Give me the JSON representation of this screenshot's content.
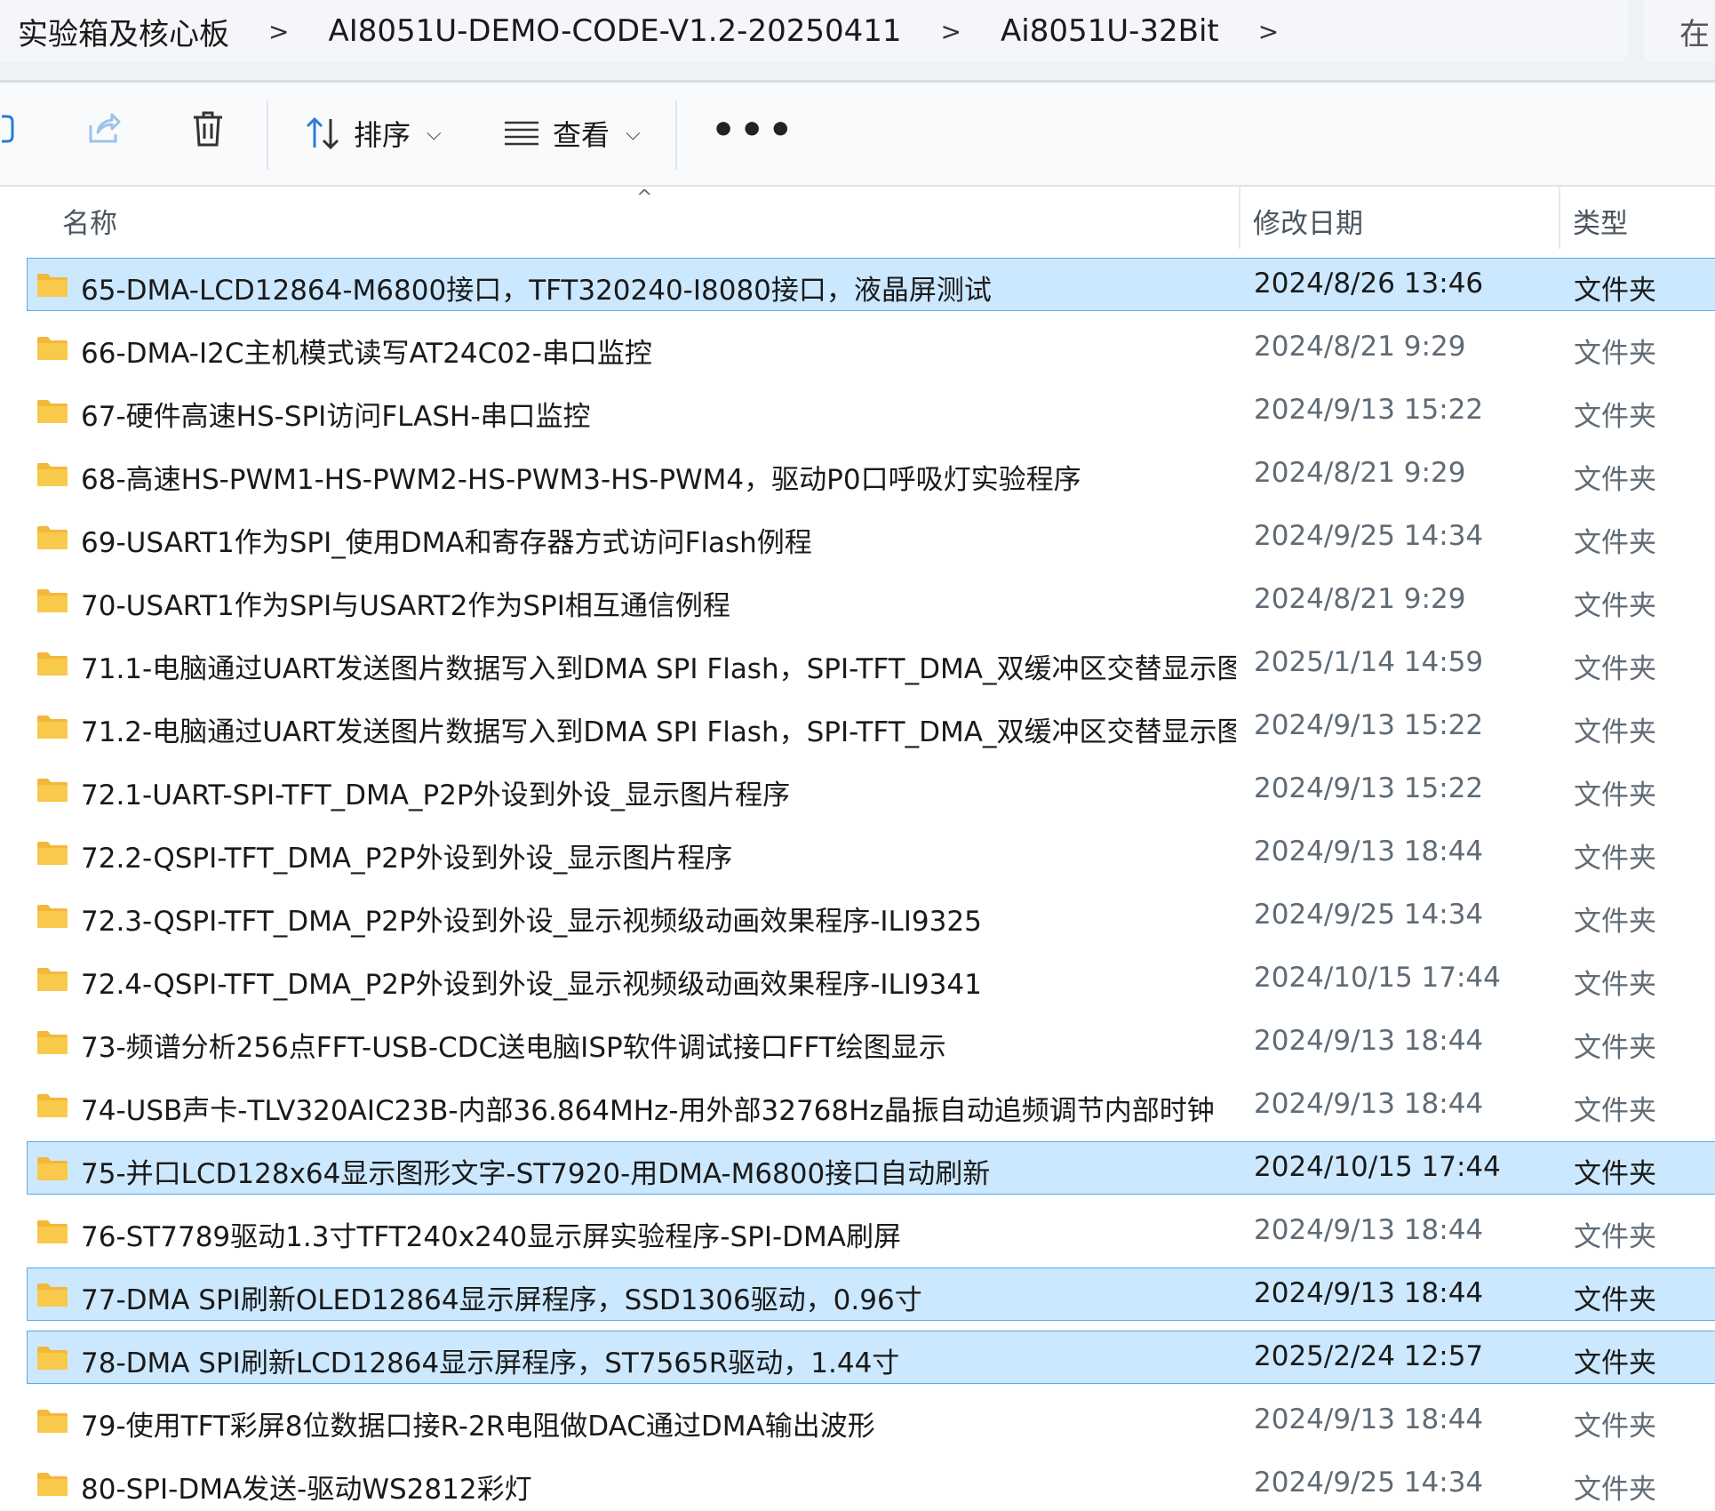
{
  "breadcrumb": {
    "items": [
      "实验箱及核心板",
      "AI8051U-DEMO-CODE-V1.2-20250411",
      "Ai8051U-32Bit"
    ],
    "separator": ">"
  },
  "search": {
    "placeholder": "在"
  },
  "toolbar": {
    "sort_label": "排序",
    "view_label": "查看",
    "more_label": "•••"
  },
  "columns": {
    "name": "名称",
    "modified": "修改日期",
    "type": "类型"
  },
  "files": [
    {
      "name": "65-DMA-LCD12864-M6800接口，TFT320240-I8080接口，液晶屏测试",
      "modified": "2024/8/26 13:46",
      "type": "文件夹",
      "selected": true
    },
    {
      "name": "66-DMA-I2C主机模式读写AT24C02-串口监控",
      "modified": "2024/8/21 9:29",
      "type": "文件夹",
      "selected": false
    },
    {
      "name": "67-硬件高速HS-SPI访问FLASH-串口监控",
      "modified": "2024/9/13 15:22",
      "type": "文件夹",
      "selected": false
    },
    {
      "name": "68-高速HS-PWM1-HS-PWM2-HS-PWM3-HS-PWM4，驱动P0口呼吸灯实验程序",
      "modified": "2024/8/21 9:29",
      "type": "文件夹",
      "selected": false
    },
    {
      "name": "69-USART1作为SPI_使用DMA和寄存器方式访问Flash例程",
      "modified": "2024/9/25 14:34",
      "type": "文件夹",
      "selected": false
    },
    {
      "name": "70-USART1作为SPI与USART2作为SPI相互通信例程",
      "modified": "2024/8/21 9:29",
      "type": "文件夹",
      "selected": false
    },
    {
      "name": "71.1-电脑通过UART发送图片数据写入到DMA SPI Flash，SPI-TFT_DMA_双缓冲区交替显示图...",
      "modified": "2025/1/14 14:59",
      "type": "文件夹",
      "selected": false
    },
    {
      "name": "71.2-电脑通过UART发送图片数据写入到DMA SPI Flash，SPI-TFT_DMA_双缓冲区交替显示图...",
      "modified": "2024/9/13 15:22",
      "type": "文件夹",
      "selected": false
    },
    {
      "name": "72.1-UART-SPI-TFT_DMA_P2P外设到外设_显示图片程序",
      "modified": "2024/9/13 15:22",
      "type": "文件夹",
      "selected": false
    },
    {
      "name": "72.2-QSPI-TFT_DMA_P2P外设到外设_显示图片程序",
      "modified": "2024/9/13 18:44",
      "type": "文件夹",
      "selected": false
    },
    {
      "name": "72.3-QSPI-TFT_DMA_P2P外设到外设_显示视频级动画效果程序-ILI9325",
      "modified": "2024/9/25 14:34",
      "type": "文件夹",
      "selected": false
    },
    {
      "name": "72.4-QSPI-TFT_DMA_P2P外设到外设_显示视频级动画效果程序-ILI9341",
      "modified": "2024/10/15 17:44",
      "type": "文件夹",
      "selected": false
    },
    {
      "name": "73-频谱分析256点FFT-USB-CDC送电脑ISP软件调试接口FFT绘图显示",
      "modified": "2024/9/13 18:44",
      "type": "文件夹",
      "selected": false
    },
    {
      "name": "74-USB声卡-TLV320AIC23B-内部36.864MHz-用外部32768Hz晶振自动追频调节内部时钟",
      "modified": "2024/9/13 18:44",
      "type": "文件夹",
      "selected": false
    },
    {
      "name": "75-并口LCD128x64显示图形文字-ST7920-用DMA-M6800接口自动刷新",
      "modified": "2024/10/15 17:44",
      "type": "文件夹",
      "selected": true
    },
    {
      "name": "76-ST7789驱动1.3寸TFT240x240显示屏实验程序-SPI-DMA刷屏",
      "modified": "2024/9/13 18:44",
      "type": "文件夹",
      "selected": false
    },
    {
      "name": "77-DMA SPI刷新OLED12864显示屏程序，SSD1306驱动，0.96寸",
      "modified": "2024/9/13 18:44",
      "type": "文件夹",
      "selected": true
    },
    {
      "name": "78-DMA SPI刷新LCD12864显示屏程序，ST7565R驱动，1.44寸",
      "modified": "2025/2/24 12:57",
      "type": "文件夹",
      "selected": true
    },
    {
      "name": "79-使用TFT彩屏8位数据口接R-2R电阻做DAC通过DMA输出波形",
      "modified": "2024/9/13 18:44",
      "type": "文件夹",
      "selected": false
    },
    {
      "name": "80-SPI-DMA发送-驱动WS2812彩灯",
      "modified": "2024/9/25 14:34",
      "type": "文件夹",
      "selected": false
    }
  ],
  "colors": {
    "selection_bg": "#cce8ff",
    "selection_border": "#5aa9e6",
    "folder_yellow": "#f8c94a"
  }
}
